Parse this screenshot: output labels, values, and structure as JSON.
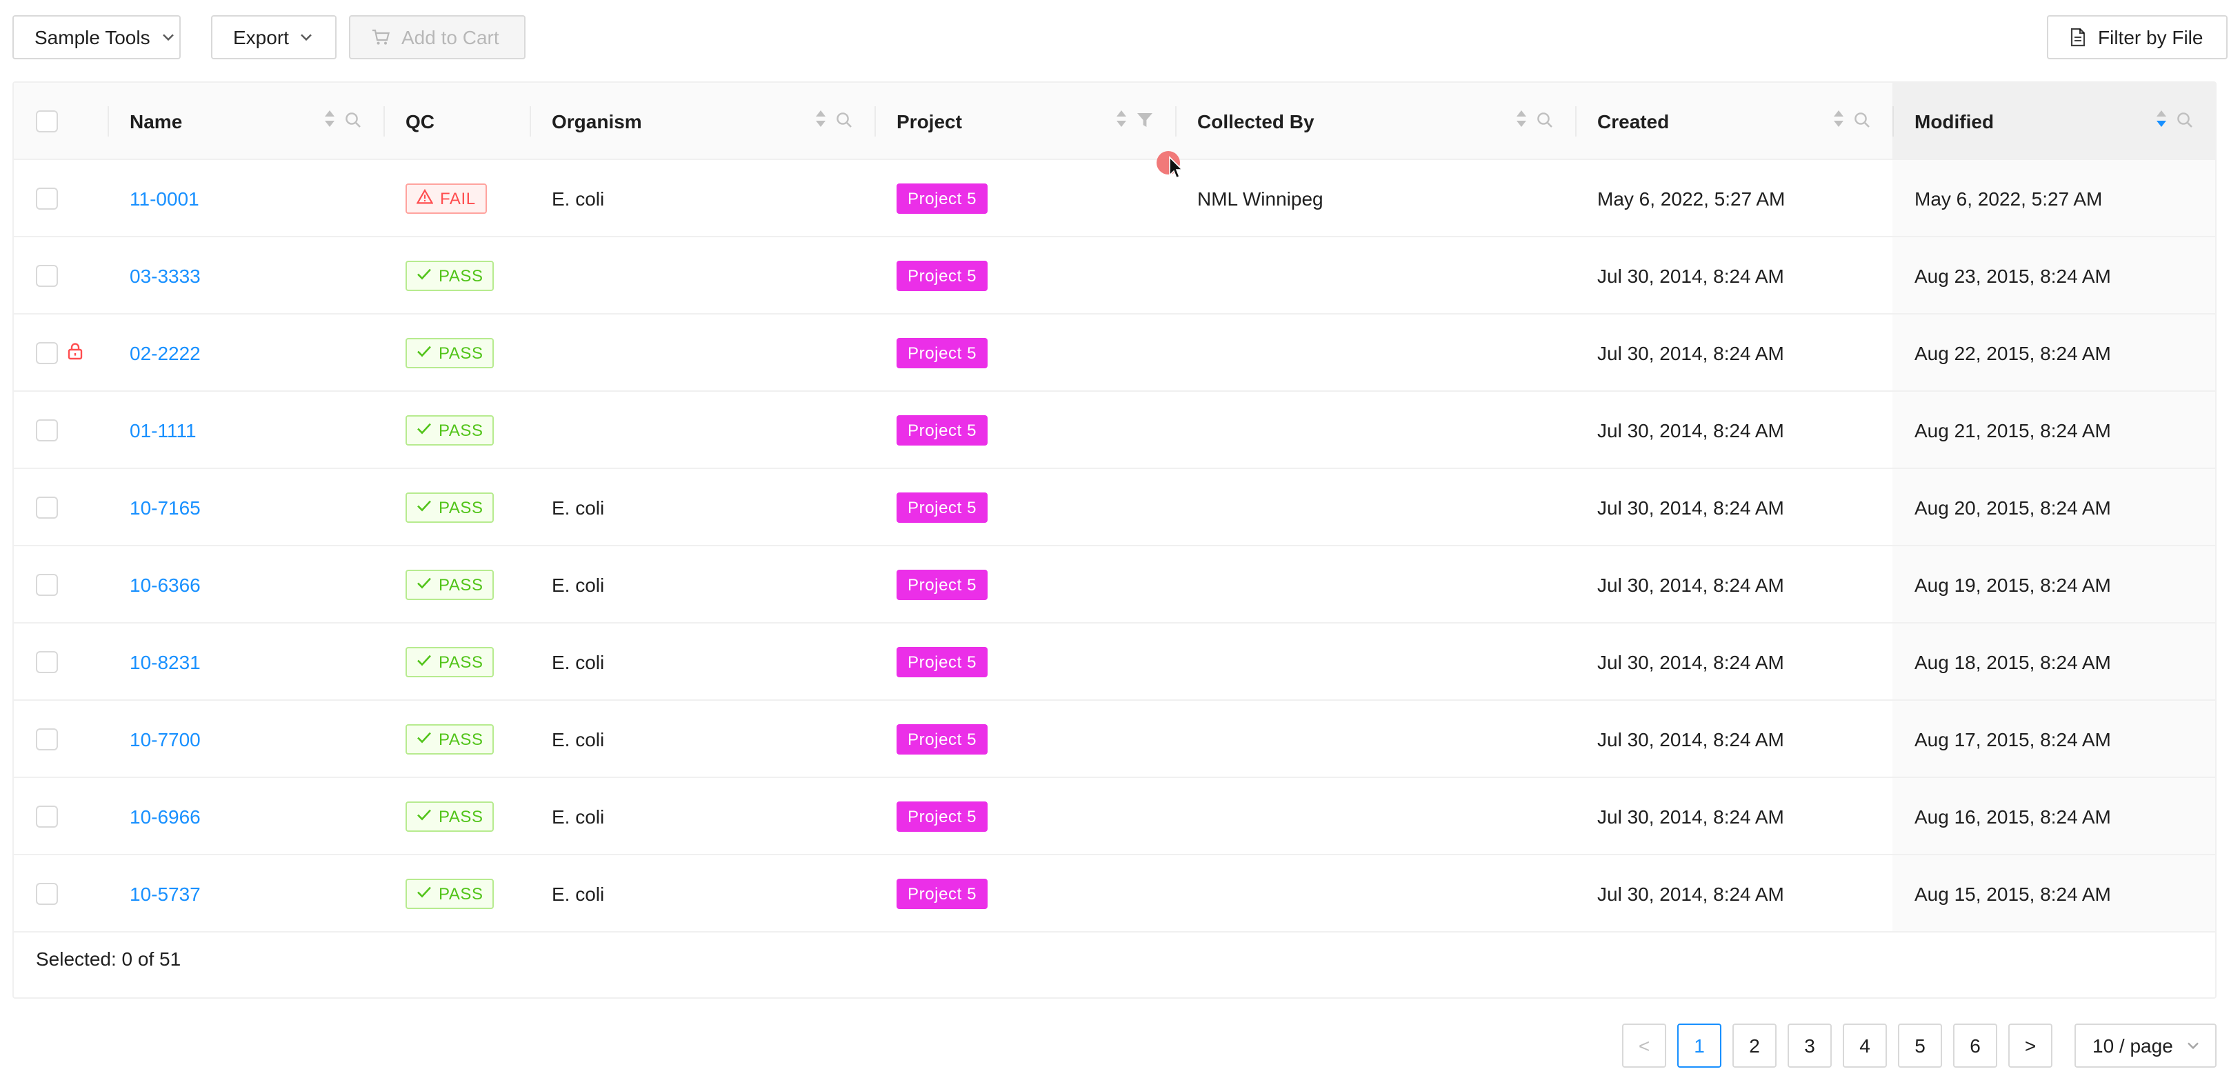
{
  "toolbar": {
    "sample_tools": "Sample Tools",
    "export": "Export",
    "add_to_cart": "Add to Cart",
    "filter_by_file": "Filter by File"
  },
  "table": {
    "columns": {
      "name": "Name",
      "qc": "QC",
      "organism": "Organism",
      "project": "Project",
      "collected_by": "Collected By",
      "created": "Created",
      "modified": "Modified"
    },
    "sorted_column": "Modified",
    "rows": [
      {
        "name": "11-0001",
        "qc": "FAIL",
        "organism": "E. coli",
        "project": "Project 5",
        "collected_by": "NML Winnipeg",
        "created": "May 6, 2022, 5:27 AM",
        "modified": "May 6, 2022, 5:27 AM",
        "locked": false
      },
      {
        "name": "03-3333",
        "qc": "PASS",
        "organism": "",
        "project": "Project 5",
        "collected_by": "",
        "created": "Jul 30, 2014, 8:24 AM",
        "modified": "Aug 23, 2015, 8:24 AM",
        "locked": false
      },
      {
        "name": "02-2222",
        "qc": "PASS",
        "organism": "",
        "project": "Project 5",
        "collected_by": "",
        "created": "Jul 30, 2014, 8:24 AM",
        "modified": "Aug 22, 2015, 8:24 AM",
        "locked": true
      },
      {
        "name": "01-1111",
        "qc": "PASS",
        "organism": "",
        "project": "Project 5",
        "collected_by": "",
        "created": "Jul 30, 2014, 8:24 AM",
        "modified": "Aug 21, 2015, 8:24 AM",
        "locked": false
      },
      {
        "name": "10-7165",
        "qc": "PASS",
        "organism": "E. coli",
        "project": "Project 5",
        "collected_by": "",
        "created": "Jul 30, 2014, 8:24 AM",
        "modified": "Aug 20, 2015, 8:24 AM",
        "locked": false
      },
      {
        "name": "10-6366",
        "qc": "PASS",
        "organism": "E. coli",
        "project": "Project 5",
        "collected_by": "",
        "created": "Jul 30, 2014, 8:24 AM",
        "modified": "Aug 19, 2015, 8:24 AM",
        "locked": false
      },
      {
        "name": "10-8231",
        "qc": "PASS",
        "organism": "E. coli",
        "project": "Project 5",
        "collected_by": "",
        "created": "Jul 30, 2014, 8:24 AM",
        "modified": "Aug 18, 2015, 8:24 AM",
        "locked": false
      },
      {
        "name": "10-7700",
        "qc": "PASS",
        "organism": "E. coli",
        "project": "Project 5",
        "collected_by": "",
        "created": "Jul 30, 2014, 8:24 AM",
        "modified": "Aug 17, 2015, 8:24 AM",
        "locked": false
      },
      {
        "name": "10-6966",
        "qc": "PASS",
        "organism": "E. coli",
        "project": "Project 5",
        "collected_by": "",
        "created": "Jul 30, 2014, 8:24 AM",
        "modified": "Aug 16, 2015, 8:24 AM",
        "locked": false
      },
      {
        "name": "10-5737",
        "qc": "PASS",
        "organism": "E. coli",
        "project": "Project 5",
        "collected_by": "",
        "created": "Jul 30, 2014, 8:24 AM",
        "modified": "Aug 15, 2015, 8:24 AM",
        "locked": false
      }
    ],
    "selected_text": "Selected: 0 of 51"
  },
  "pagination": {
    "prev": "<",
    "pages": [
      "1",
      "2",
      "3",
      "4",
      "5",
      "6"
    ],
    "current": "1",
    "next": ">",
    "page_size": "10 / page"
  },
  "colors": {
    "link": "#1890ff",
    "pass": "#52c41a",
    "fail": "#ff4d4f",
    "project_tag": "#eb2fe8",
    "lock_icon": "#ff4d4f",
    "sort_active": "#1890ff"
  },
  "icons": {
    "dropdown": "chevron-down-icon",
    "cart": "shopping-cart-icon",
    "file": "file-text-icon",
    "sort": "sort-icon",
    "search": "search-icon",
    "filter": "filter-icon",
    "pass": "check-icon",
    "fail": "warning-icon",
    "locked": "lock-icon"
  }
}
